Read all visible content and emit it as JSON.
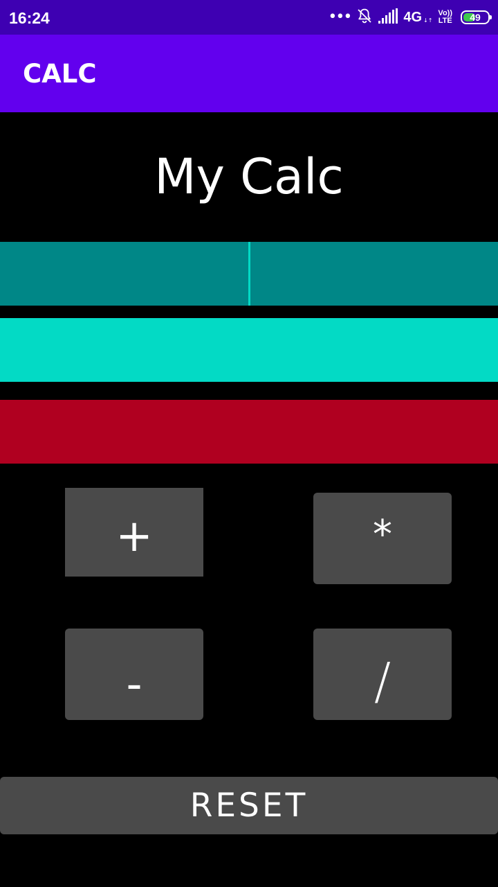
{
  "status_bar": {
    "time": "16:24",
    "network": "4G",
    "network_sub": "↓↑",
    "volte_top": "Vo))",
    "volte_bottom": "LTE",
    "battery_level": "49",
    "battery_fill_percent": 49,
    "icons": [
      "more-dots-icon",
      "bell-off-icon",
      "signal-bars-icon",
      "battery-icon"
    ],
    "colors": {
      "background": "#3e00b2",
      "battery_fill": "#3ec94b"
    }
  },
  "app_bar": {
    "title": "CALC",
    "color": "#6200ee"
  },
  "main": {
    "heading": "My Calc",
    "first_number": {
      "value": "",
      "placeholder": ""
    },
    "second_number": {
      "value": "",
      "placeholder": ""
    },
    "result": {
      "value": ""
    },
    "colors": {
      "first_field": "#008787",
      "second_field": "#03dac5",
      "result": "#b00020",
      "button": "#4a4a4a"
    }
  },
  "buttons": {
    "plus": "+",
    "multiply": "*",
    "minus": "-",
    "divide": "/",
    "reset": "RESET"
  }
}
